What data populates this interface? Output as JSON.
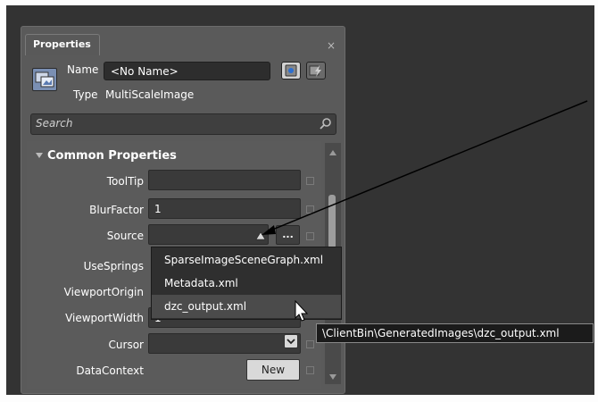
{
  "panel": {
    "tab_title": "Properties",
    "close_glyph": "×",
    "name_label": "Name",
    "name_value": "<No Name>",
    "type_label": "Type",
    "type_value": "MultiScaleImage",
    "search_placeholder": "Search"
  },
  "section": {
    "title": "Common Properties",
    "rows": [
      {
        "label": "ToolTip",
        "value": ""
      },
      {
        "label": "BlurFactor",
        "value": "1"
      },
      {
        "label": "Source",
        "value": ""
      },
      {
        "label": "UseSprings",
        "value": ""
      },
      {
        "label": "ViewportOrigin",
        "value": ""
      },
      {
        "label": "ViewportWidth",
        "value": "1"
      },
      {
        "label": "Cursor",
        "value": ""
      },
      {
        "label": "DataContext",
        "value": ""
      }
    ],
    "browse_label": "...",
    "new_label": "New"
  },
  "dropdown": {
    "items": [
      "SparseImageSceneGraph.xml",
      "Metadata.xml",
      "dzc_output.xml"
    ],
    "hover_index": 2
  },
  "tooltip": "\\ClientBin\\GeneratedImages\\dzc_output.xml",
  "colors": {
    "panel_bg": "#5a5a5a",
    "canvas_bg": "#333333",
    "field_bg": "#3a3a3a",
    "dropdown_bg": "#2f2f2f"
  }
}
